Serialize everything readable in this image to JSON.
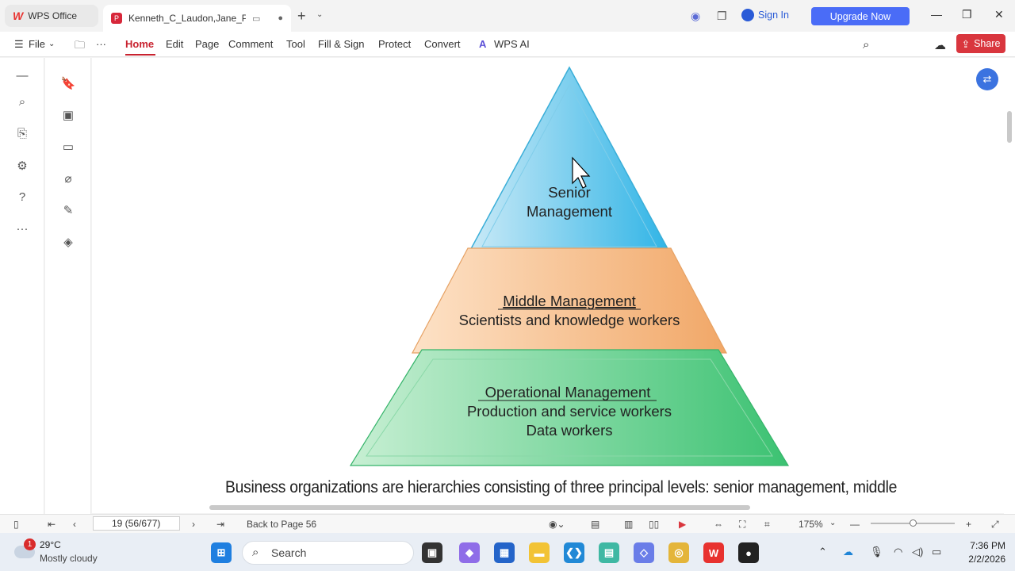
{
  "titlebar": {
    "home_tab": "WPS Office",
    "doc_tab": "Kenneth_C_Laudon,Jane_P_l",
    "signin": "Sign In",
    "upgrade": "Upgrade Now"
  },
  "menu": {
    "file": "File",
    "items": [
      "Home",
      "Edit",
      "Page",
      "Comment",
      "Tool",
      "Fill & Sign",
      "Protect",
      "Convert"
    ],
    "wps_ai": "WPS AI",
    "share": "Share"
  },
  "document": {
    "pyramid": {
      "top_line1": "Senior",
      "top_line2": "Management",
      "middle_title": "Middle Management",
      "middle_sub": "Scientists and knowledge workers",
      "bottom_title": "Operational Management",
      "bottom_sub1": "Production and service workers",
      "bottom_sub2": "Data workers"
    },
    "caption": "Business organizations are hierarchies consisting of three principal levels: senior management, middle"
  },
  "status": {
    "page": "19 (56/677)",
    "back": "Back to Page 56",
    "zoom": "175%"
  },
  "taskbar": {
    "temp": "29°C",
    "condition": "Mostly cloudy",
    "badge": "1",
    "search": "Search",
    "time": "7:36 PM",
    "date": "2/2/2026"
  },
  "colors": {
    "accent": "#c8222f",
    "upgrade": "#4a6cf7",
    "senior": "#4fc0e8",
    "middle": "#f2b27a",
    "operational": "#4ccb7e"
  }
}
